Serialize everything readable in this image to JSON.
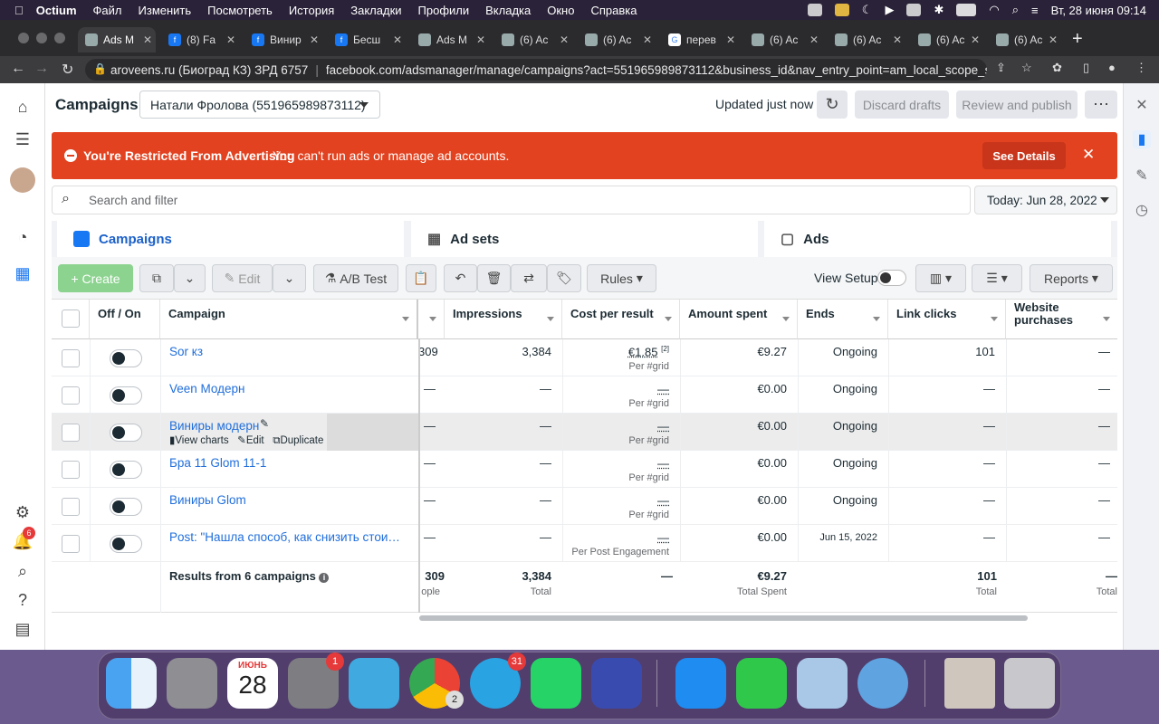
{
  "menubar": {
    "app": "Octium",
    "items": [
      "Файл",
      "Изменить",
      "Посмотреть",
      "История",
      "Закладки",
      "Профили",
      "Вкладка",
      "Окно",
      "Справка"
    ],
    "clock": "Вт, 28 июня  09:14"
  },
  "browser": {
    "tabs": [
      {
        "label": "Ads M"
      },
      {
        "label": "(8) Fa"
      },
      {
        "label": "Винир"
      },
      {
        "label": "Бесш"
      },
      {
        "label": "Ads M"
      },
      {
        "label": "(6) Ac"
      },
      {
        "label": "(6) Ac"
      },
      {
        "label": "перев"
      },
      {
        "label": "(6) Ac"
      },
      {
        "label": "(6) Ac"
      },
      {
        "label": "(6) Ac"
      },
      {
        "label": "(6) Ac"
      }
    ],
    "site_info": "aroveens.ru (Биоград КЗ) ЗРД 6757",
    "url": "facebook.com/adsmanager/manage/campaigns?act=551965989873112&business_id&nav_entry_point=am_local_scope_s..."
  },
  "header": {
    "title": "Campaigns",
    "account": "Натали Фролова (551965989873112)",
    "updated": "Updated just now",
    "discard": "Discard drafts",
    "review": "Review and publish"
  },
  "banner": {
    "title": "You're Restricted From Advertising",
    "message": "You can't run ads or manage ad accounts.",
    "button": "See Details"
  },
  "search": {
    "placeholder": "Search and filter",
    "date": "Today: Jun 28, 2022"
  },
  "levels": {
    "campaigns": "Campaigns",
    "adsets": "Ad sets",
    "ads": "Ads"
  },
  "toolbar": {
    "create": "Create",
    "edit": "Edit",
    "abtest": "A/B Test",
    "rules": "Rules",
    "view_setup": "View Setup",
    "reports": "Reports"
  },
  "table": {
    "headers": {
      "offon": "Off / On",
      "campaign": "Campaign",
      "impressions": "Impressions",
      "cpr": "Cost per result",
      "spent": "Amount spent",
      "ends": "Ends",
      "clicks": "Link clicks",
      "purchases": "Website purchases"
    },
    "rows": [
      {
        "name": "Sor кз",
        "reach": "309",
        "impressions": "3,384",
        "cpr": "€1.85",
        "cpr_note": "[2]",
        "cpr_sub": "Per #grid",
        "spent": "€9.27",
        "ends": "Ongoing",
        "clicks": "101",
        "purchases": "—"
      },
      {
        "name": "Veen Модерн",
        "reach": "—",
        "impressions": "—",
        "cpr": "—",
        "cpr_note": "",
        "cpr_sub": "Per #grid",
        "spent": "€0.00",
        "ends": "Ongoing",
        "clicks": "—",
        "purchases": "—"
      },
      {
        "name": "Виниры модерн",
        "reach": "—",
        "impressions": "—",
        "cpr": "—",
        "cpr_note": "",
        "cpr_sub": "Per #grid",
        "spent": "€0.00",
        "ends": "Ongoing",
        "clicks": "—",
        "purchases": "—"
      },
      {
        "name": "Бра 11 Glom 11-1",
        "reach": "—",
        "impressions": "—",
        "cpr": "—",
        "cpr_note": "",
        "cpr_sub": "Per #grid",
        "spent": "€0.00",
        "ends": "Ongoing",
        "clicks": "—",
        "purchases": "—"
      },
      {
        "name": "Виниры Glom",
        "reach": "—",
        "impressions": "—",
        "cpr": "—",
        "cpr_note": "",
        "cpr_sub": "Per #grid",
        "spent": "€0.00",
        "ends": "Ongoing",
        "clicks": "—",
        "purchases": "—"
      },
      {
        "name": "Post: \"Нашла способ, как снизить стоимост...",
        "reach": "—",
        "impressions": "—",
        "cpr": "—",
        "cpr_note": "",
        "cpr_sub": "Per Post Engagement",
        "spent": "€0.00",
        "ends": "Jun 15, 2022",
        "clicks": "—",
        "purchases": "—"
      }
    ],
    "hover_actions": {
      "view_charts": "View charts",
      "edit": "Edit",
      "duplicate": "Duplicate"
    },
    "totals": {
      "label": "Results from 6 campaigns",
      "reach": "309",
      "reach_sub": "ople",
      "impressions": "3,384",
      "impressions_sub": "Total",
      "cpr": "—",
      "spent": "€9.27",
      "spent_sub": "Total Spent",
      "clicks": "101",
      "clicks_sub": "Total",
      "purchases": "—",
      "purchases_sub": "Total"
    }
  },
  "dock": {
    "calendar_month": "ИЮНЬ",
    "calendar_day": "28",
    "settings_badge": "1",
    "telegram_badge": "31",
    "chrome_badge": "2",
    "notif_badge": "6"
  },
  "colors": {
    "accent": "#1877f2",
    "banner": "#e2421f",
    "link": "#216fdb",
    "create": "#8bd38f"
  }
}
